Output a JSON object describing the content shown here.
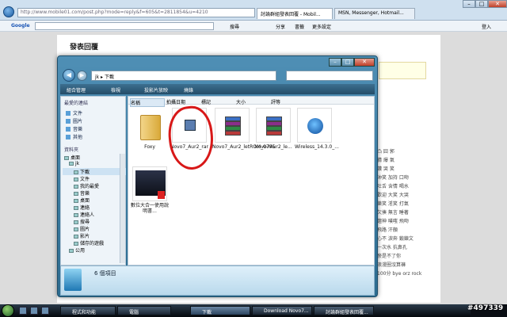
{
  "browser": {
    "address": "http://www.mobile01.com/post.php?mode=reply&f=605&t=2811854&u=4210",
    "tabs": [
      "討論群組發表回覆 - Mobil...",
      "MSN, Messenger, Hotmail..."
    ],
    "google_label": "Google",
    "toolbar_items": [
      "搜尋",
      "分享",
      "書籤",
      "更多設定",
      "登入"
    ]
  },
  "page": {
    "title": "發表回覆",
    "side_grid": [
      "凸 囧 郭",
      "猜 爆 氣",
      "讚 哭 笑",
      "沖笑 加持 口吻",
      "吐舌 含情 喝水",
      "歡迎 大笑 大哭",
      "樂笑 淫笑 打氣",
      "欠揍 無言 睡著",
      "趨神 噗嗤 飛吻",
      "飛路 汗顏",
      "心不 淚奔 鍛鍊文",
      "一次水 抗鼻孔",
      "瘀是不了你",
      "浪漫圈沒算褲",
      "100分 bye orz rock"
    ]
  },
  "explorer": {
    "path": "jk ▸ 下載",
    "toolbar": [
      "組合管理",
      "檢視",
      "投影片放映",
      "燒錄"
    ],
    "favorites_header": "最愛的連結",
    "favorites": [
      "文件",
      "圖片",
      "音樂",
      "其他"
    ],
    "folders_header": "資料夾",
    "tree": [
      "桌面",
      "jk",
      "下載",
      "文件",
      "我的最愛",
      "音樂",
      "桌面",
      "連絡",
      "連絡人",
      "搜尋",
      "圖片",
      "影片",
      "儲存的遊戲",
      "公用"
    ],
    "columns": [
      "名稱",
      "拍攝日期",
      "標記",
      "大小",
      "評等"
    ],
    "files": [
      {
        "name": "Foxy",
        "icon": "folder-icon"
      },
      {
        "name": "Novo7_Aur2_rar",
        "icon": "installer-icon"
      },
      {
        "name": "Novo7_Aur2_letROM_0705",
        "icon": "winrar-archive-icon"
      },
      {
        "name": "Novo7Aur2_le...",
        "icon": "winrar-archive-icon"
      },
      {
        "name": "Wireless_14.3.0_...",
        "icon": "wireless-icon"
      },
      {
        "name": "數位大合一使用說明書...",
        "icon": "pdf-icon"
      }
    ],
    "status": "6 個項目"
  },
  "taskbar": {
    "buttons": [
      "程式和功能",
      "電腦",
      "下載",
      "Download Novo7...",
      "討論群組發表回覆..."
    ]
  },
  "watermark": "#497339"
}
